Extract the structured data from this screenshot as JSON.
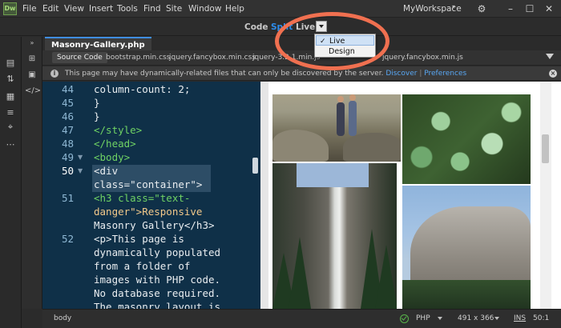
{
  "menubar": {
    "logo": "Dw",
    "items": [
      "File",
      "Edit",
      "View",
      "Insert",
      "Tools",
      "Find",
      "Site",
      "Window",
      "Help"
    ],
    "workspace": "MyWorkspace"
  },
  "viewbar": {
    "code": "Code",
    "split": "Split",
    "live": "Live"
  },
  "dropdown": {
    "items": [
      {
        "label": "Live",
        "selected": true
      },
      {
        "label": "Design",
        "selected": false
      }
    ]
  },
  "document": {
    "tab": "Masonry-Gallery.php"
  },
  "related_files": [
    "Source Code",
    "bootstrap.min.css",
    "jquery.fancybox.min.css",
    "jquery-3.2.1.min.js",
    "jquery.fancybox.min.js"
  ],
  "infobar": {
    "text": "This page may have dynamically-related files that can only be discovered by the server.",
    "discover": "Discover",
    "separator": "|",
    "preferences": "Preferences"
  },
  "code": {
    "line_numbers": [
      "44",
      "45",
      "46",
      "47",
      "48",
      "49",
      "50",
      "51",
      "52"
    ],
    "lines": [
      {
        "no": "44",
        "text": "column-count: 2;"
      },
      {
        "no": "45",
        "text": "}"
      },
      {
        "no": "46",
        "text": "}"
      },
      {
        "no": "47",
        "text": "</style>"
      },
      {
        "no": "48",
        "text": "</head>"
      },
      {
        "no": "49",
        "text": "<body>"
      },
      {
        "no": "50",
        "text": "<div"
      },
      {
        "no": "",
        "text": "class=\"container\">"
      },
      {
        "no": "51",
        "text": "<h3 class=\"text-"
      },
      {
        "no": "",
        "text": "danger\">Responsive"
      },
      {
        "no": "",
        "text": "Masonry Gallery</h3>"
      },
      {
        "no": "52",
        "text": "<p>This page is"
      },
      {
        "no": "",
        "text": "dynamically populated"
      },
      {
        "no": "",
        "text": "from a folder of"
      },
      {
        "no": "",
        "text": "images with PHP code."
      },
      {
        "no": "",
        "text": "No database required."
      },
      {
        "no": "",
        "text": "The masonry layout is"
      }
    ]
  },
  "statusbar": {
    "tag": "body",
    "language": "PHP",
    "dimensions": "491 x 366",
    "mode": "INS",
    "position": "50:1"
  },
  "colors": {
    "accent": "#2d8ceb",
    "code_bg": "#0f3048",
    "tag": "#6fd264",
    "string": "#f2c98a",
    "annotation": "#f07050"
  }
}
